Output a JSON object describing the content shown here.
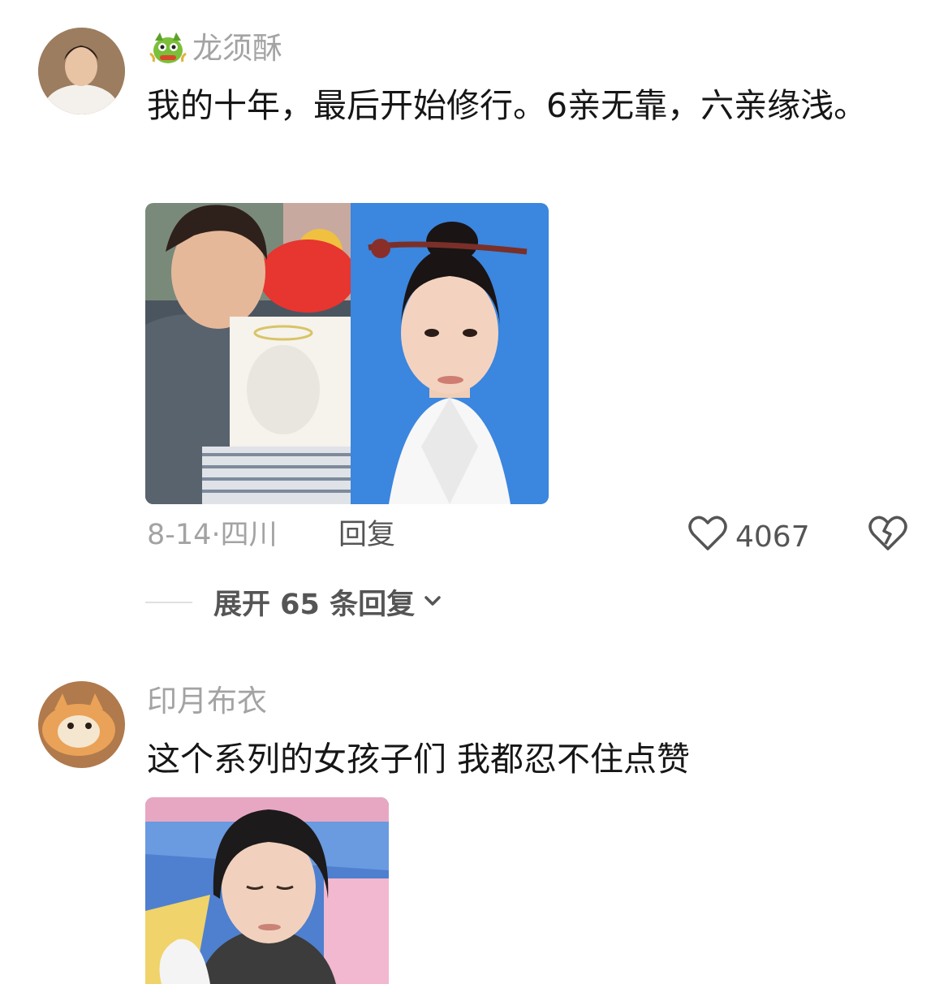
{
  "comments": [
    {
      "username": "龙须酥",
      "badge_icon": "dragon-badge-icon",
      "text": "我的十年，最后开始修行。6亲无靠，六亲缘浅。",
      "date": "8-14",
      "location": "四川",
      "reply_label": "回复",
      "like_count": "4067",
      "expand_label": "展开 65 条回复"
    },
    {
      "username": "印月布衣",
      "text": "这个系列的女孩子们 我都忍不住点赞"
    }
  ],
  "colors": {
    "username": "#a3a3a3",
    "text": "#161616",
    "id_photo_bg": "#3b86de"
  }
}
